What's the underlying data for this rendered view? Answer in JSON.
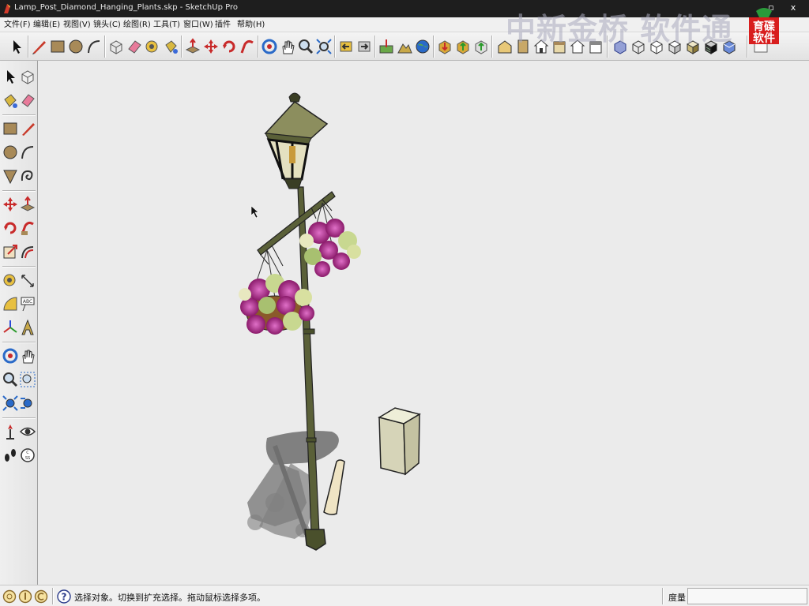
{
  "window": {
    "title": "Lamp_Post_Diamond_Hanging_Plants.skp - SketchUp Pro",
    "minimize_glyph": "▫",
    "close_glyph": "x"
  },
  "menu": {
    "items": [
      {
        "label": "文件(F)",
        "name": "menu-file"
      },
      {
        "label": "编辑(E)",
        "name": "menu-edit"
      },
      {
        "label": "视图(V)",
        "name": "menu-view"
      },
      {
        "label": "镜头(C)",
        "name": "menu-camera"
      },
      {
        "label": "绘图(R)",
        "name": "menu-draw"
      },
      {
        "label": "工具(T)",
        "name": "menu-tools"
      },
      {
        "label": "窗口(W)",
        "name": "menu-window"
      },
      {
        "label": "插件",
        "name": "menu-plugins"
      },
      {
        "label": "帮助(H)",
        "name": "menu-help"
      }
    ]
  },
  "watermark": {
    "text": "中新金桥 软件通",
    "logo_line1": "育碟",
    "logo_line2": "软件"
  },
  "status": {
    "text": "选择对象。切换到扩充选择。拖动鼠标选择多项。",
    "measure_label": "度量",
    "measure_value": ""
  },
  "colors": {
    "titlebar": "#1e1e1e",
    "viewport": "#ebebeb",
    "lamp_green": "#5a6038",
    "flower_pink": "#b03a8c",
    "logo_red": "#d81e1e"
  }
}
